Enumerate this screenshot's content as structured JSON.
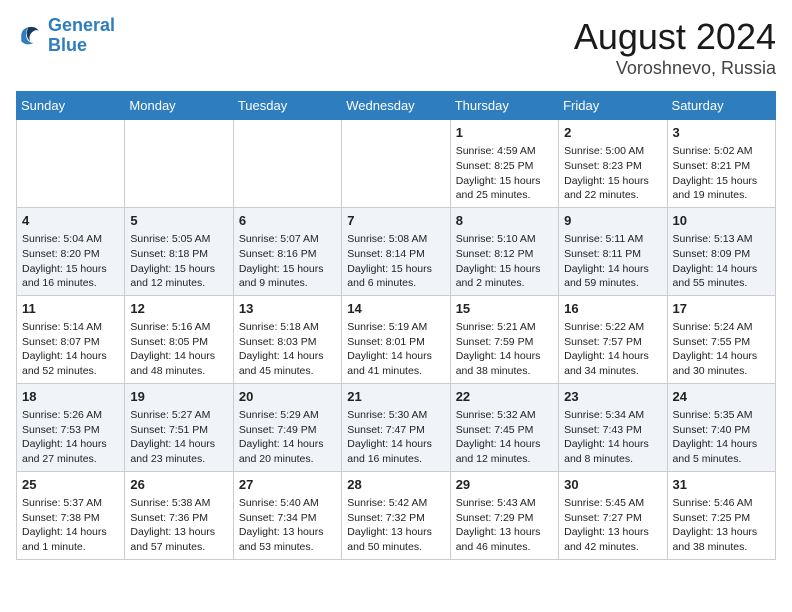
{
  "header": {
    "logo_line1": "General",
    "logo_line2": "Blue",
    "title": "August 2024",
    "subtitle": "Voroshnevo, Russia"
  },
  "days_of_week": [
    "Sunday",
    "Monday",
    "Tuesday",
    "Wednesday",
    "Thursday",
    "Friday",
    "Saturday"
  ],
  "weeks": [
    [
      {
        "day": "",
        "content": ""
      },
      {
        "day": "",
        "content": ""
      },
      {
        "day": "",
        "content": ""
      },
      {
        "day": "",
        "content": ""
      },
      {
        "day": "1",
        "content": "Sunrise: 4:59 AM\nSunset: 8:25 PM\nDaylight: 15 hours\nand 25 minutes."
      },
      {
        "day": "2",
        "content": "Sunrise: 5:00 AM\nSunset: 8:23 PM\nDaylight: 15 hours\nand 22 minutes."
      },
      {
        "day": "3",
        "content": "Sunrise: 5:02 AM\nSunset: 8:21 PM\nDaylight: 15 hours\nand 19 minutes."
      }
    ],
    [
      {
        "day": "4",
        "content": "Sunrise: 5:04 AM\nSunset: 8:20 PM\nDaylight: 15 hours\nand 16 minutes."
      },
      {
        "day": "5",
        "content": "Sunrise: 5:05 AM\nSunset: 8:18 PM\nDaylight: 15 hours\nand 12 minutes."
      },
      {
        "day": "6",
        "content": "Sunrise: 5:07 AM\nSunset: 8:16 PM\nDaylight: 15 hours\nand 9 minutes."
      },
      {
        "day": "7",
        "content": "Sunrise: 5:08 AM\nSunset: 8:14 PM\nDaylight: 15 hours\nand 6 minutes."
      },
      {
        "day": "8",
        "content": "Sunrise: 5:10 AM\nSunset: 8:12 PM\nDaylight: 15 hours\nand 2 minutes."
      },
      {
        "day": "9",
        "content": "Sunrise: 5:11 AM\nSunset: 8:11 PM\nDaylight: 14 hours\nand 59 minutes."
      },
      {
        "day": "10",
        "content": "Sunrise: 5:13 AM\nSunset: 8:09 PM\nDaylight: 14 hours\nand 55 minutes."
      }
    ],
    [
      {
        "day": "11",
        "content": "Sunrise: 5:14 AM\nSunset: 8:07 PM\nDaylight: 14 hours\nand 52 minutes."
      },
      {
        "day": "12",
        "content": "Sunrise: 5:16 AM\nSunset: 8:05 PM\nDaylight: 14 hours\nand 48 minutes."
      },
      {
        "day": "13",
        "content": "Sunrise: 5:18 AM\nSunset: 8:03 PM\nDaylight: 14 hours\nand 45 minutes."
      },
      {
        "day": "14",
        "content": "Sunrise: 5:19 AM\nSunset: 8:01 PM\nDaylight: 14 hours\nand 41 minutes."
      },
      {
        "day": "15",
        "content": "Sunrise: 5:21 AM\nSunset: 7:59 PM\nDaylight: 14 hours\nand 38 minutes."
      },
      {
        "day": "16",
        "content": "Sunrise: 5:22 AM\nSunset: 7:57 PM\nDaylight: 14 hours\nand 34 minutes."
      },
      {
        "day": "17",
        "content": "Sunrise: 5:24 AM\nSunset: 7:55 PM\nDaylight: 14 hours\nand 30 minutes."
      }
    ],
    [
      {
        "day": "18",
        "content": "Sunrise: 5:26 AM\nSunset: 7:53 PM\nDaylight: 14 hours\nand 27 minutes."
      },
      {
        "day": "19",
        "content": "Sunrise: 5:27 AM\nSunset: 7:51 PM\nDaylight: 14 hours\nand 23 minutes."
      },
      {
        "day": "20",
        "content": "Sunrise: 5:29 AM\nSunset: 7:49 PM\nDaylight: 14 hours\nand 20 minutes."
      },
      {
        "day": "21",
        "content": "Sunrise: 5:30 AM\nSunset: 7:47 PM\nDaylight: 14 hours\nand 16 minutes."
      },
      {
        "day": "22",
        "content": "Sunrise: 5:32 AM\nSunset: 7:45 PM\nDaylight: 14 hours\nand 12 minutes."
      },
      {
        "day": "23",
        "content": "Sunrise: 5:34 AM\nSunset: 7:43 PM\nDaylight: 14 hours\nand 8 minutes."
      },
      {
        "day": "24",
        "content": "Sunrise: 5:35 AM\nSunset: 7:40 PM\nDaylight: 14 hours\nand 5 minutes."
      }
    ],
    [
      {
        "day": "25",
        "content": "Sunrise: 5:37 AM\nSunset: 7:38 PM\nDaylight: 14 hours\nand 1 minute."
      },
      {
        "day": "26",
        "content": "Sunrise: 5:38 AM\nSunset: 7:36 PM\nDaylight: 13 hours\nand 57 minutes."
      },
      {
        "day": "27",
        "content": "Sunrise: 5:40 AM\nSunset: 7:34 PM\nDaylight: 13 hours\nand 53 minutes."
      },
      {
        "day": "28",
        "content": "Sunrise: 5:42 AM\nSunset: 7:32 PM\nDaylight: 13 hours\nand 50 minutes."
      },
      {
        "day": "29",
        "content": "Sunrise: 5:43 AM\nSunset: 7:29 PM\nDaylight: 13 hours\nand 46 minutes."
      },
      {
        "day": "30",
        "content": "Sunrise: 5:45 AM\nSunset: 7:27 PM\nDaylight: 13 hours\nand 42 minutes."
      },
      {
        "day": "31",
        "content": "Sunrise: 5:46 AM\nSunset: 7:25 PM\nDaylight: 13 hours\nand 38 minutes."
      }
    ]
  ]
}
